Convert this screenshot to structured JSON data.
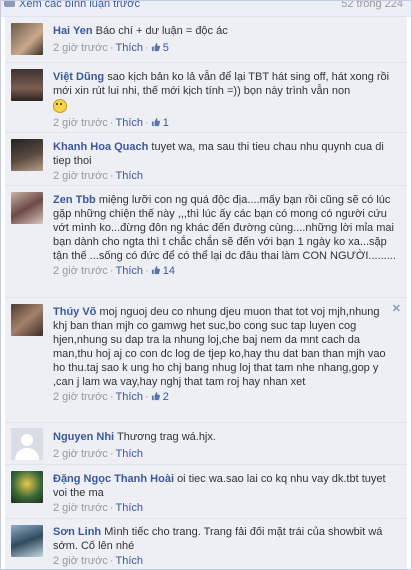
{
  "header": {
    "prev_link": "Xem các bình luận trước",
    "count": "52 trong 224"
  },
  "actions": {
    "like": "Thích"
  },
  "comments": [
    {
      "name": "Hai Yen",
      "text": "Báo chí + dư luận = độc ác",
      "time": "2 giờ trước",
      "likes": "5"
    },
    {
      "name": "Việt Dũng",
      "text": "sao kịch bản ko lả vẫn để lại TBT hát sing off, hát xong rồi mới xin rút lui nhi, thế mới kịch tính =)) bọn này trình vẫn non",
      "time": "2 giờ trước",
      "likes": "1"
    },
    {
      "name": "Khanh Hoa Quach",
      "text": "tuyet wa, ma sau thi tieu chau nhu quynh cua di tiep thoi",
      "time": "2 giờ trước",
      "likes": ""
    },
    {
      "name": "Zen Tbb",
      "text": "miệng lưỡi con ng quá độc địa....mấy bạn rồi cũng sẽ có lúc gặp những chiện thế này ,,,thì lúc ấy các bạn có mong có người cứu vớt mình ko...đừng đôn ng khác đến đường cùng....những lời mỉa mai bạn dành cho ngta thì t chắc chắn sẽ đến với bạn 1 ngày ko xa...sặp tận thế ...sống có đức để có thể lại dc đâu thai làm CON NGƯỜI.........",
      "time": "2 giờ trước",
      "likes": "14"
    },
    {
      "name": "Thúy Võ",
      "text": "moj nguoj deu co nhung djeu muon that tot voj mjh,nhung khj ban than mjh co gamwg het suc,bo cong suc tap luyen cog hjen,nhung su dap tra la nhung loj,che baj nem da mnt cach da man,thu hoj aj co con dc log de tjep ko,hay thu dat ban than mjh vao ho thu.taj sao k ung ho chj bang nhug loj that tam nhe nhang,gop y ,can j lam wa vay,hay nghj that tam roj hay nhan xet",
      "time": "2 giờ trước",
      "likes": "2"
    },
    {
      "name": "Nguyen Nhi",
      "text": "Thương trag wá.hjx.",
      "time": "2 giờ trước",
      "likes": ""
    },
    {
      "name": "Đặng Ngọc Thanh Hoài",
      "text": "oi tiec wa.sao lai co kq nhu vay dk.tbt tuyet voi the ma",
      "time": "2 giờ trước",
      "likes": ""
    },
    {
      "name": "Sơn Linh",
      "text": "Mình tiếc cho trang. Trang fải đối mặt trái của showbit wá sớm. Cố lên nhé",
      "time": "2 giờ trước",
      "likes": ""
    }
  ],
  "colors": {
    "link": "#3b5998",
    "comment_bg": "#edeff4",
    "meta": "#999999"
  },
  "icons": [
    "comment-bubble-icon",
    "thumbs-up-icon",
    "smiley-icon",
    "close-icon"
  ]
}
